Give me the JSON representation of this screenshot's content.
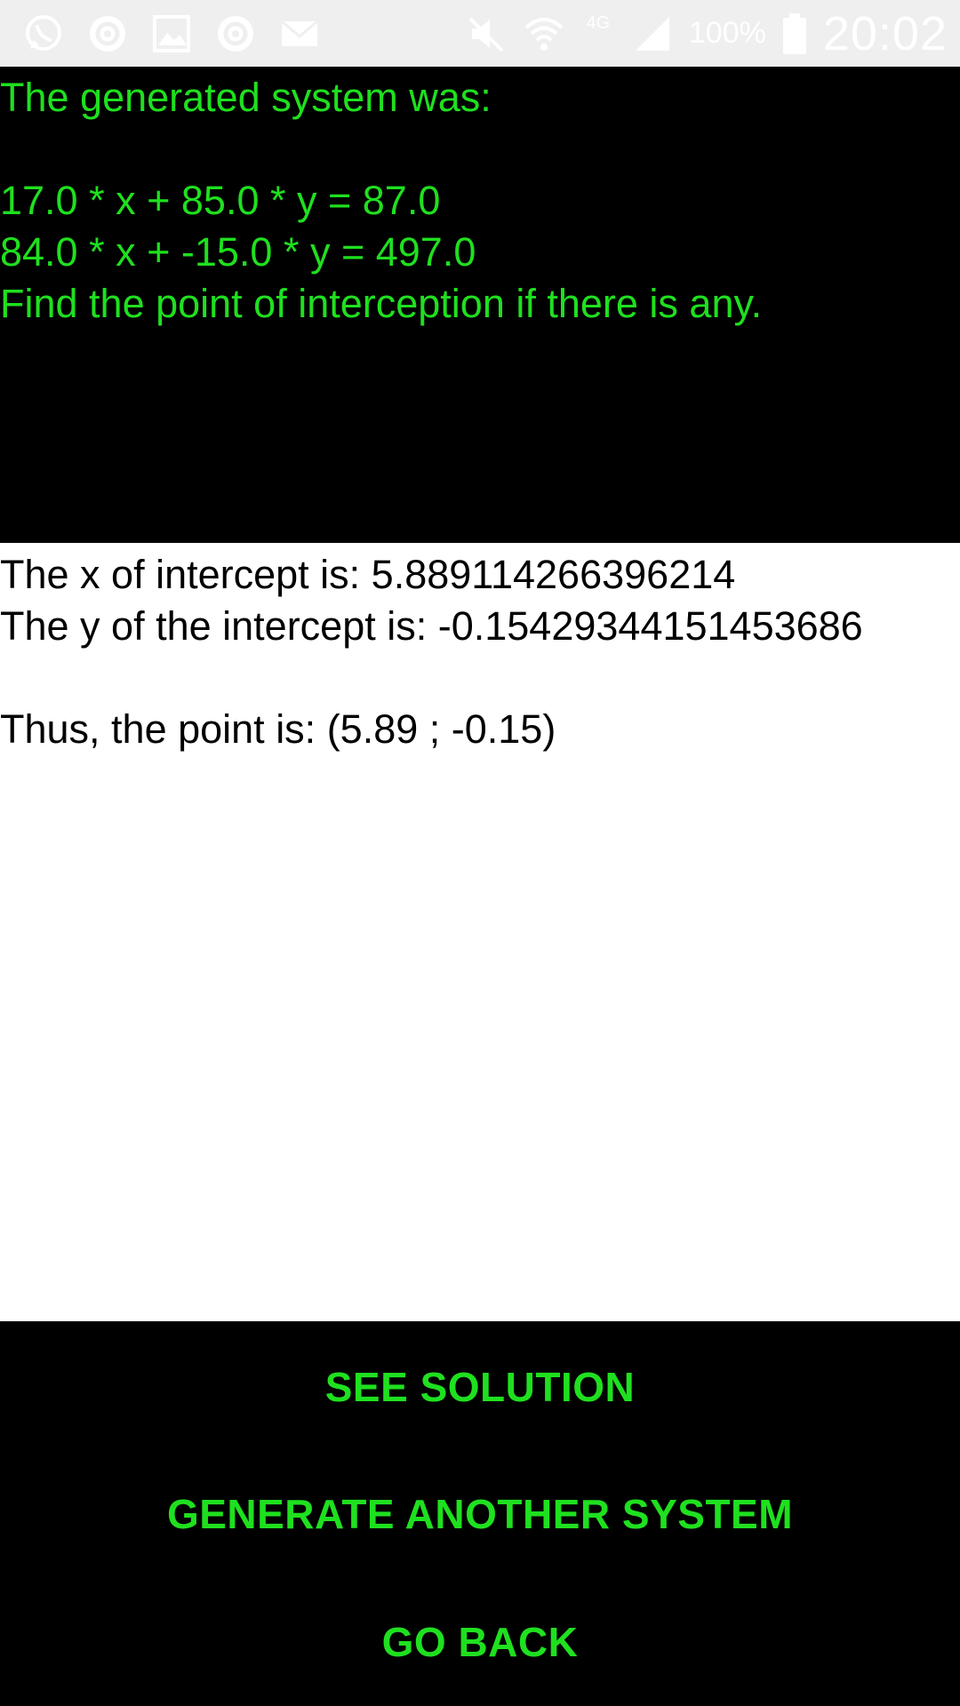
{
  "status_bar": {
    "icons": [
      "whatsapp-icon",
      "swirl-app-icon",
      "gallery-icon",
      "swirl-app-icon",
      "mail-icon",
      "mute-icon",
      "wifi-icon",
      "4g-icon",
      "signal-icon",
      "battery-icon"
    ],
    "network_label": "4G",
    "battery_percent": "100%",
    "clock": "20:02"
  },
  "problem": {
    "heading": "The generated system was:",
    "equation_1": "17.0 * x + 85.0 * y = 87.0",
    "equation_2": "84.0 * x + -15.0 * y = 497.0",
    "prompt": "Find the point of interception if there is any."
  },
  "solution": {
    "x_line": "The x of intercept is: 5.889114266396214",
    "y_line": "The y of the intercept is: -0.15429344151453686",
    "point_line": "Thus, the point is: (5.89 ; -0.15)"
  },
  "buttons": {
    "see_solution": "SEE SOLUTION",
    "generate_another": "GENERATE ANOTHER SYSTEM",
    "go_back": "GO BACK"
  },
  "colors": {
    "accent_green": "#1fe01f",
    "panel_black": "#000000",
    "status_bar_bg": "#efefef"
  }
}
